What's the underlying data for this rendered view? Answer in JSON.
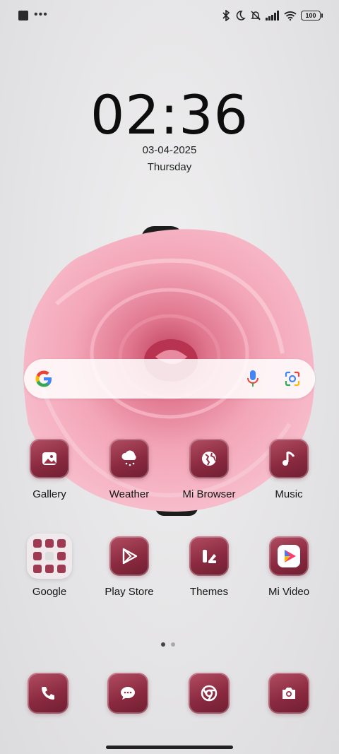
{
  "status_bar": {
    "battery": "100",
    "icons": [
      "bluetooth-icon",
      "do-not-disturb-icon",
      "notifications-off-icon",
      "signal-icon",
      "wifi-icon",
      "battery-icon"
    ]
  },
  "clock": {
    "time": "02:36",
    "date": "03-04-2025",
    "day": "Thursday"
  },
  "search": {
    "icons": [
      "google-logo",
      "mic-icon",
      "lens-icon"
    ]
  },
  "apps_row1": [
    {
      "label": "Gallery",
      "icon": "gallery-icon"
    },
    {
      "label": "Weather",
      "icon": "weather-icon"
    },
    {
      "label": "Mi Browser",
      "icon": "globe-icon"
    },
    {
      "label": "Music",
      "icon": "music-icon"
    }
  ],
  "apps_row2": [
    {
      "label": "Google",
      "icon": "google-folder-icon"
    },
    {
      "label": "Play Store",
      "icon": "play-store-icon"
    },
    {
      "label": "Themes",
      "icon": "themes-icon"
    },
    {
      "label": "Mi Video",
      "icon": "mi-video-icon"
    }
  ],
  "dock": [
    "phone-icon",
    "messages-icon",
    "chrome-icon",
    "camera-icon"
  ],
  "pager": {
    "pages": 2,
    "current": 1
  },
  "colors": {
    "tile": "#8b2a40",
    "rose": "#f3a6b8"
  }
}
